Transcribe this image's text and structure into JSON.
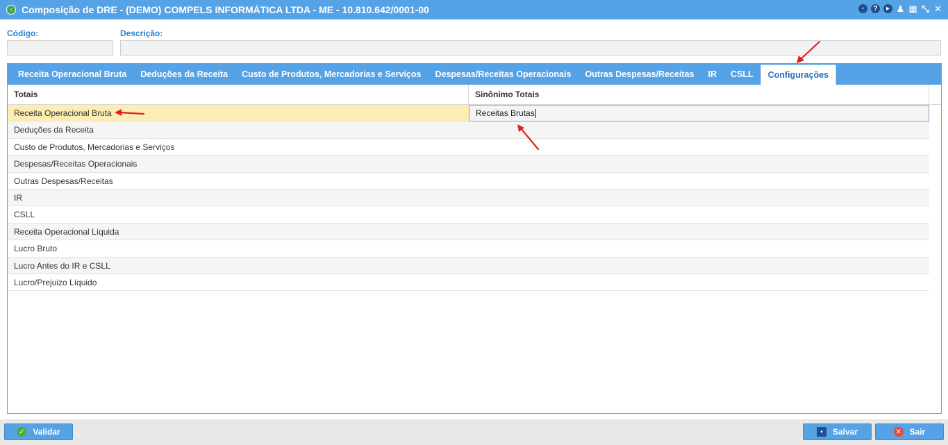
{
  "window": {
    "title": "Composição de DRE - (DEMO) COMPELS INFORMÁTICA LTDA - ME - 10.810.642/0001-00"
  },
  "form": {
    "codigo_label": "Código:",
    "codigo_value": "",
    "descricao_label": "Descrição:",
    "descricao_value": ""
  },
  "tabs": [
    {
      "label": "Receita Operacional Bruta"
    },
    {
      "label": "Deduções da Receita"
    },
    {
      "label": "Custo de Produtos, Mercadorias e Serviços"
    },
    {
      "label": "Despesas/Receitas Operacionais"
    },
    {
      "label": "Outras Despesas/Receitas"
    },
    {
      "label": "IR"
    },
    {
      "label": "CSLL"
    },
    {
      "label": "Configurações"
    }
  ],
  "active_tab": "Configurações",
  "grid": {
    "columns": [
      "Totais",
      "Sinônimo Totais"
    ],
    "rows": [
      {
        "totais": "Receita Operacional Bruta",
        "sinonimo": "Receitas Brutas"
      },
      {
        "totais": "Deduções da Receita",
        "sinonimo": ""
      },
      {
        "totais": "Custo de Produtos, Mercadorias e Serviços",
        "sinonimo": ""
      },
      {
        "totais": "Despesas/Receitas Operacionais",
        "sinonimo": ""
      },
      {
        "totais": "Outras Despesas/Receitas",
        "sinonimo": ""
      },
      {
        "totais": "IR",
        "sinonimo": ""
      },
      {
        "totais": "CSLL",
        "sinonimo": ""
      },
      {
        "totais": "Receita Operacional Líquida",
        "sinonimo": ""
      },
      {
        "totais": "Lucro Bruto",
        "sinonimo": ""
      },
      {
        "totais": "Lucro Antes do IR e CSLL",
        "sinonimo": ""
      },
      {
        "totais": "Lucro/Prejuizo Líquido",
        "sinonimo": ""
      }
    ]
  },
  "footer": {
    "validar_label": "Validar",
    "salvar_label": "Salvar",
    "sair_label": "Sair"
  },
  "colors": {
    "accent": "#55a2e6",
    "selected_row": "#fbedb3",
    "annotation_arrow": "#e02020"
  }
}
